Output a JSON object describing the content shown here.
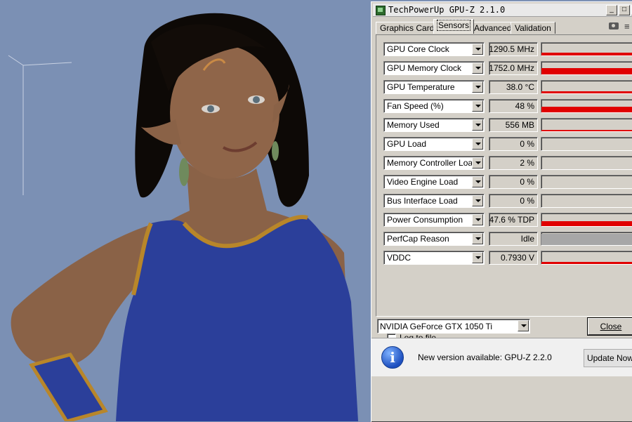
{
  "window": {
    "title": "TechPowerUp GPU-Z 2.1.0",
    "minimize_glyph": "_",
    "maximize_glyph": "□",
    "close_glyph": "×"
  },
  "tabs": [
    {
      "label": "Graphics Card",
      "active": false
    },
    {
      "label": "Sensors",
      "active": true
    },
    {
      "label": "Advanced",
      "active": false
    },
    {
      "label": "Validation",
      "active": false
    }
  ],
  "toolbar": {
    "camera_icon": "camera-icon",
    "menu_icon": "hamburger-menu-icon",
    "menu_glyph": "≡"
  },
  "sensors": [
    {
      "name": "GPU Core Clock",
      "value": "1290.5 MHz",
      "level": 0.25,
      "style": "red"
    },
    {
      "name": "GPU Memory Clock",
      "value": "1752.0 MHz",
      "level": 0.55,
      "style": "red"
    },
    {
      "name": "GPU Temperature",
      "value": "38.0 °C",
      "level": 0.2,
      "style": "red"
    },
    {
      "name": "Fan Speed (%)",
      "value": "48 %",
      "level": 0.5,
      "style": "red"
    },
    {
      "name": "Memory Used",
      "value": "556 MB",
      "level": 0.12,
      "style": "red"
    },
    {
      "name": "GPU Load",
      "value": "0 %",
      "level": 0,
      "style": "red"
    },
    {
      "name": "Memory Controller Load",
      "value": "2 %",
      "level": 0,
      "style": "red"
    },
    {
      "name": "Video Engine Load",
      "value": "0 %",
      "level": 0,
      "style": "red"
    },
    {
      "name": "Bus Interface Load",
      "value": "0 %",
      "level": 0,
      "style": "red"
    },
    {
      "name": "Power Consumption",
      "value": "47.6 % TDP",
      "level": 0.45,
      "style": "red"
    },
    {
      "name": "PerfCap Reason",
      "value": "Idle",
      "level": 1,
      "style": "grey"
    },
    {
      "name": "VDDC",
      "value": "0.7930 V",
      "level": 0.2,
      "style": "red"
    }
  ],
  "log": {
    "label": "Log to file",
    "checked": false
  },
  "gpu_select": {
    "selected": "NVIDIA GeForce GTX 1050 Ti"
  },
  "buttons": {
    "close_label": "Close",
    "update_label": "Update Now"
  },
  "update_notice": {
    "text": "New version available: GPU-Z 2.2.0",
    "icon": "info-icon",
    "icon_glyph": "i"
  },
  "colors": {
    "graph_red": "#e00000",
    "graph_grey": "#a7a7a7",
    "desktop_bg": "#7b90b4",
    "dress_blue": "#2b3f9a",
    "trim_gold": "#b8862a",
    "skin": "#8a6247"
  }
}
